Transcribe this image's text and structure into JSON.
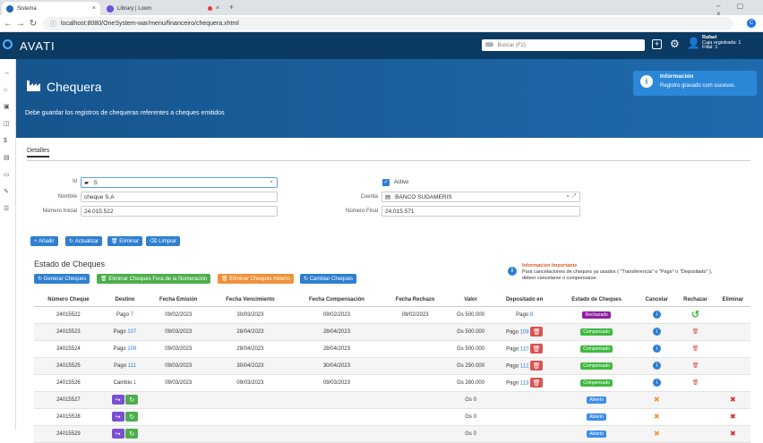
{
  "browser": {
    "tabs": [
      {
        "label": "Sistema"
      },
      {
        "label": "Library | Loom"
      }
    ],
    "url": "localhost:8080/OneSystem-war/menu/financeiro/chequera.xhtml"
  },
  "header": {
    "logo": "AVATI",
    "search_placeholder": "Buscar (F2)",
    "user_name": "Rafael",
    "user_line1": "Caja registrada: 1",
    "user_line2": "Filial: 1"
  },
  "page": {
    "title": "Chequera",
    "subtitle": "Debe guardar los registros de chequeras referentes a cheques emitidos"
  },
  "toast": {
    "title": "Información",
    "message": "Registro gravado com sucesso."
  },
  "tabs": [
    {
      "label": "Detalles"
    }
  ],
  "form": {
    "id_label": "Id",
    "id_value": "5",
    "activo_label": "Activo",
    "nombre_label": "Nombre",
    "nombre_value": "cheque S.A",
    "cuenta_label": "Cuenta",
    "cuenta_value": "BANCO SUDAMERIS",
    "num_inicial_label": "Número Inicial",
    "num_inicial_value": "24.015.522",
    "num_final_label": "Número Final",
    "num_final_value": "24.015.571"
  },
  "actions": {
    "anadir": "Añadir",
    "actualizar": "Actualizar",
    "eliminar": "Eliminar",
    "limpiar": "Limpiar"
  },
  "estado": {
    "title": "Estado de Cheques",
    "btn_generar": "Generar Cheques",
    "btn_elim_fuera": "Eliminar Cheques Fora de la Numeración",
    "btn_elim_abierto": "Eliminar Cheques Abierto",
    "btn_cambiar": "Cambiar Cheques",
    "info_title": "Información Importante",
    "info_text1": "Para cancelaciones de cheques ya usados ( \"Transferencia\" o \"Pago\" o \"Depositado\" ),",
    "info_text2": "deben cancelarse o compensarse."
  },
  "table": {
    "headers": [
      "Número Cheque",
      "Destino",
      "Fecha Emisión",
      "Fecha Vencimiento",
      "Fecha Compensación",
      "Fecha Rechazo",
      "Valor",
      "Depositado en",
      "Estado de Cheques",
      "Cancelar",
      "Rechazar",
      "Eliminar"
    ],
    "rows": [
      {
        "num": "24015522",
        "dest": "Pago",
        "dest_n": "7",
        "emi": "09/02/2023",
        "ven": "30/03/2023",
        "comp": "09/02/2023",
        "rech": "09/02/2023",
        "valor": "Gs 500.000",
        "dep": "Pago",
        "dep_n": "8",
        "estado": "Rechazado"
      },
      {
        "num": "24015523",
        "dest": "Pago",
        "dest_n": "107",
        "emi": "09/03/2023",
        "ven": "28/04/2023",
        "comp": "28/04/2023",
        "rech": "",
        "valor": "Gs 500.000",
        "dep": "Pago",
        "dep_n": "108",
        "estado": "Compensado"
      },
      {
        "num": "24015524",
        "dest": "Pago",
        "dest_n": "109",
        "emi": "09/03/2023",
        "ven": "28/04/2023",
        "comp": "28/04/2023",
        "rech": "",
        "valor": "Gs 500.000",
        "dep": "Pago",
        "dep_n": "110",
        "estado": "Compensado"
      },
      {
        "num": "24015525",
        "dest": "Pago",
        "dest_n": "111",
        "emi": "09/03/2023",
        "ven": "30/04/2023",
        "comp": "30/04/2023",
        "rech": "",
        "valor": "Gs 250.000",
        "dep": "Pago",
        "dep_n": "112",
        "estado": "Compensado"
      },
      {
        "num": "24015526",
        "dest": "Cambio",
        "dest_n": "1",
        "emi": "09/03/2023",
        "ven": "09/03/2023",
        "comp": "09/03/2023",
        "rech": "",
        "valor": "Gs 260.000",
        "dep": "Pago",
        "dep_n": "113",
        "estado": "Compensado"
      },
      {
        "num": "24015527",
        "dest": "",
        "dest_n": "",
        "emi": "",
        "ven": "",
        "comp": "",
        "rech": "",
        "valor": "Gs 0",
        "dep": "",
        "dep_n": "",
        "estado": "Abierto"
      },
      {
        "num": "24015528",
        "dest": "",
        "dest_n": "",
        "emi": "",
        "ven": "",
        "comp": "",
        "rech": "",
        "valor": "Gs 0",
        "dep": "",
        "dep_n": "",
        "estado": "Abierto"
      },
      {
        "num": "24015529",
        "dest": "",
        "dest_n": "",
        "emi": "",
        "ven": "",
        "comp": "",
        "rech": "",
        "valor": "Gs 0",
        "dep": "",
        "dep_n": "",
        "estado": "Abierto"
      }
    ]
  },
  "colors": {
    "rechazado": "#8e1f9e",
    "compensado": "#3fb93f",
    "abierto": "#3a8ee8",
    "danger": "#d9534f",
    "purple": "#7b4fd1"
  }
}
